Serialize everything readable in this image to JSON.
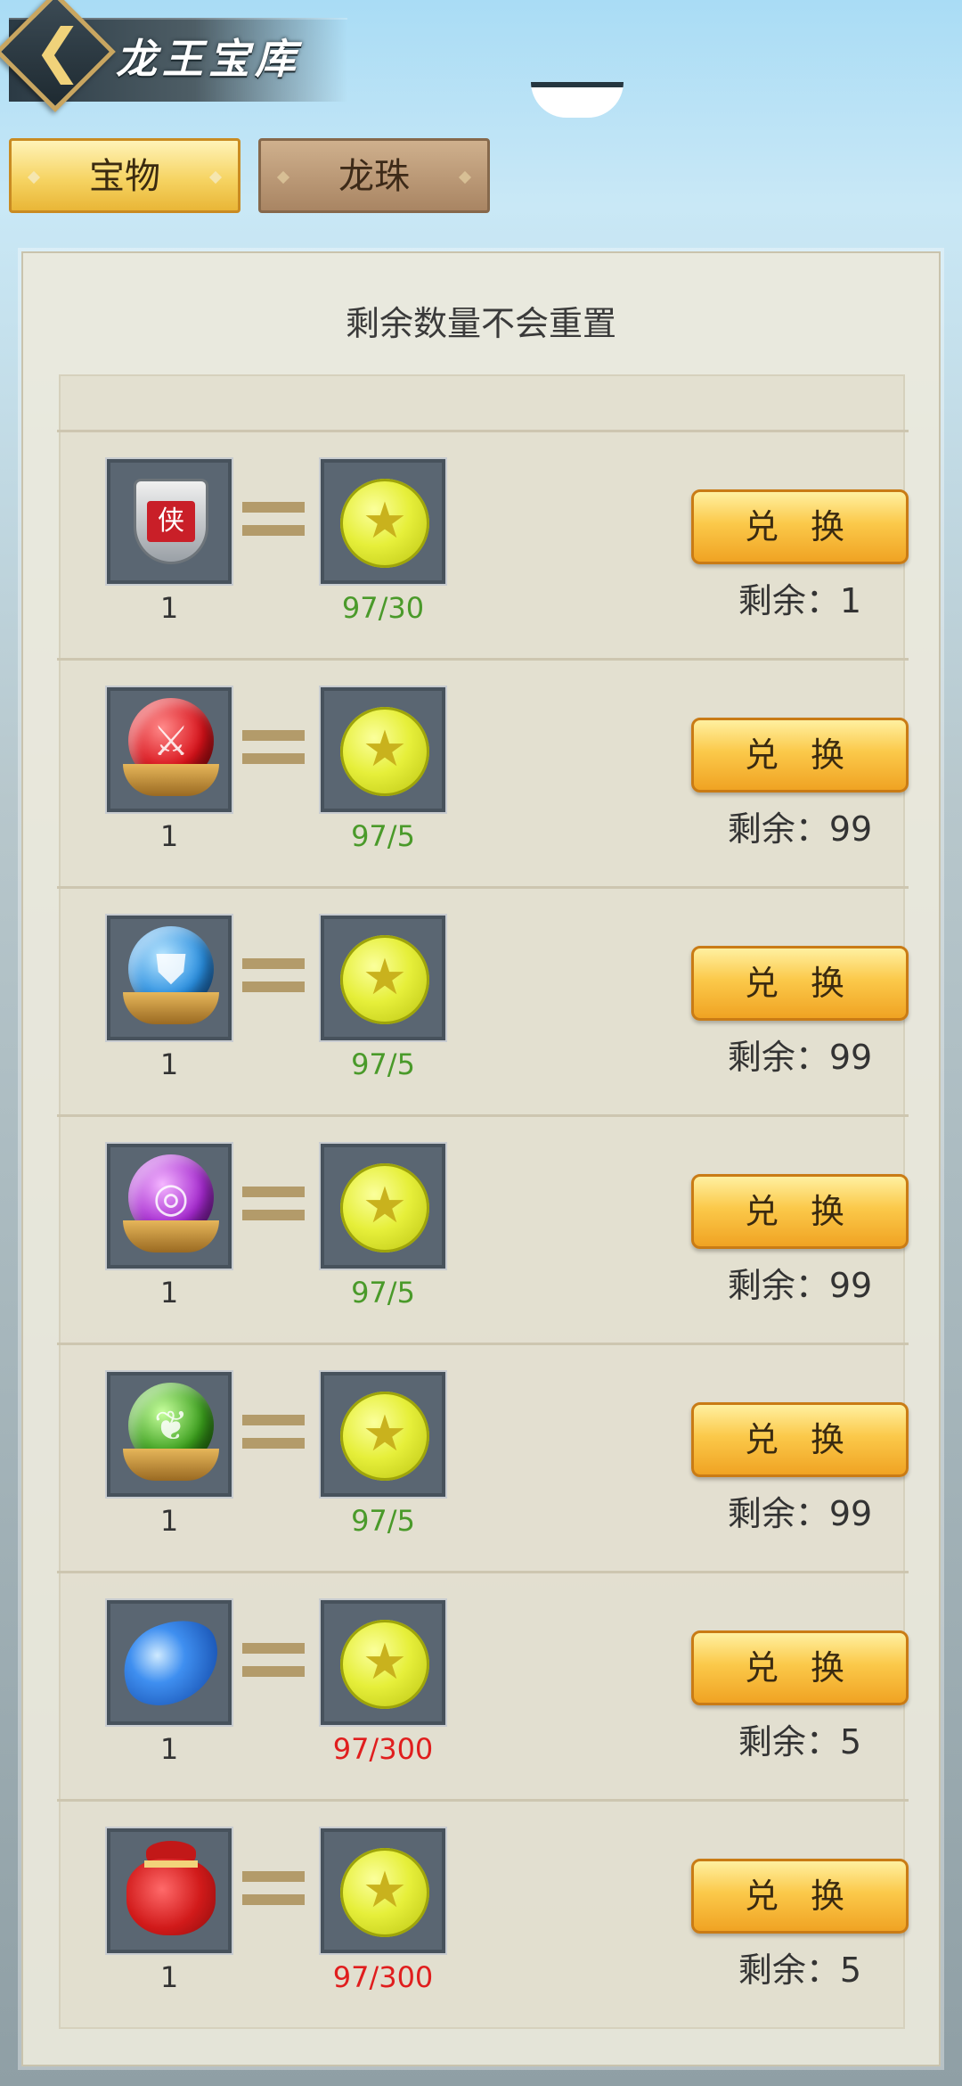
{
  "header": {
    "title": "龙王宝库"
  },
  "tabs": [
    {
      "label": "宝物",
      "active": true
    },
    {
      "label": "龙珠",
      "active": false
    }
  ],
  "notice": "剩余数量不会重置",
  "colors": {
    "ok": "#4a9a2a",
    "insufficient": "#e01e1e",
    "button": "#fbc94a"
  },
  "exchange": {
    "button_label": "兑 换",
    "rows": [
      {
        "item_icon": "shield-emblem-icon",
        "item_qty": "1",
        "cost_icon": "star-coin-icon",
        "cost": "97/30",
        "cost_status": "ok",
        "remaining": "剩余：1"
      },
      {
        "item_icon": "red-sword-orb-icon",
        "item_qty": "1",
        "cost_icon": "star-coin-icon",
        "cost": "97/5",
        "cost_status": "ok",
        "remaining": "剩余：99"
      },
      {
        "item_icon": "blue-shield-orb-icon",
        "item_qty": "1",
        "cost_icon": "star-coin-icon",
        "cost": "97/5",
        "cost_status": "ok",
        "remaining": "剩余：99"
      },
      {
        "item_icon": "purple-swirl-orb-icon",
        "item_qty": "1",
        "cost_icon": "star-coin-icon",
        "cost": "97/5",
        "cost_status": "ok",
        "remaining": "剩余：99"
      },
      {
        "item_icon": "green-leaf-orb-icon",
        "item_qty": "1",
        "cost_icon": "star-coin-icon",
        "cost": "97/5",
        "cost_status": "ok",
        "remaining": "剩余：99"
      },
      {
        "item_icon": "blue-gem-icon",
        "item_qty": "1",
        "cost_icon": "star-coin-icon",
        "cost": "97/300",
        "cost_status": "insufficient",
        "remaining": "剩余：5"
      },
      {
        "item_icon": "red-pouch-icon",
        "item_qty": "1",
        "cost_icon": "star-coin-icon",
        "cost": "97/300",
        "cost_status": "insufficient",
        "remaining": "剩余：5"
      }
    ]
  }
}
